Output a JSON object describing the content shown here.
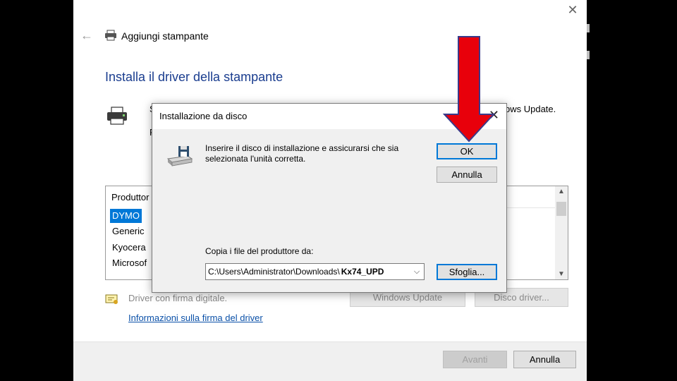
{
  "wizard": {
    "title": "Aggiungi stampante",
    "heading": "Installa il driver della stampante",
    "desc_fragment_1": "S",
    "desc_fragment_2": "P",
    "desc_tail": "ows Update.",
    "manufacturer_header": "Produttor",
    "manufacturers": [
      "DYMO",
      "Generic",
      "Kyocera",
      "Microsof"
    ],
    "selected_manufacturer_index": 0,
    "signed_driver_text": "Driver con firma digitale.",
    "signature_link": "Informazioni sulla firma del driver",
    "windows_update_button": "Windows Update",
    "disk_button": "Disco driver...",
    "next_button": "Avanti",
    "cancel_button": "Annulla"
  },
  "dialog": {
    "title": "Installazione da disco",
    "message_line1": "Inserire il disco di installazione e assicurarsi che sia",
    "message_line2": "selezionata l'unità corretta.",
    "ok_button": "OK",
    "cancel_button": "Annulla",
    "copy_label": "Copia i file del produttore da:",
    "path_prefix": "C:\\Users\\Administrator\\Downloads\\",
    "path_highlight": "Kx74_UPD",
    "browse_button": "Sfoglia..."
  },
  "icons": {
    "close": "close-icon",
    "back": "back-arrow-icon",
    "printer": "printer-icon",
    "disk": "disk-drive-icon",
    "certificate": "certificate-icon",
    "annotation": "red-arrow-annotation"
  },
  "colors": {
    "heading": "#1a3d8f",
    "selection": "#0078d7",
    "link": "#0a50a8",
    "annotation_arrow": "#e8000b"
  }
}
